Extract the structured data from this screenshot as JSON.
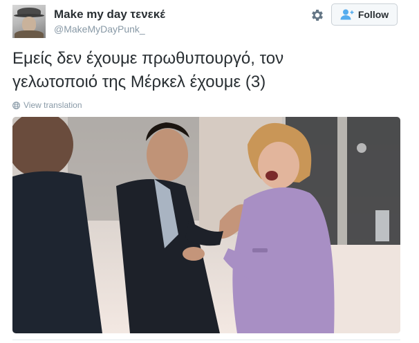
{
  "user": {
    "display_name": "Make my day τενεκέ",
    "screen_name": "@MakeMyDayPunk_",
    "avatar_icon": "profile-avatar"
  },
  "actions": {
    "settings_icon": "gear-icon",
    "follow_icon": "add-user-icon",
    "follow_label": "Follow"
  },
  "tweet": {
    "text_line1": "Εμείς δεν έχουμε πρωθυπουργό, τον",
    "text_line2": "γελωτοποιό της Μέρκελ έχουμε (3)",
    "translate_label": "View translation",
    "translate_icon": "globe-icon"
  },
  "media": {
    "type": "photo",
    "icon": "photo"
  },
  "colors": {
    "text": "#292f33",
    "secondary": "#8899a6",
    "follow_icon": "#55acee",
    "border": "#e1e8ed"
  }
}
